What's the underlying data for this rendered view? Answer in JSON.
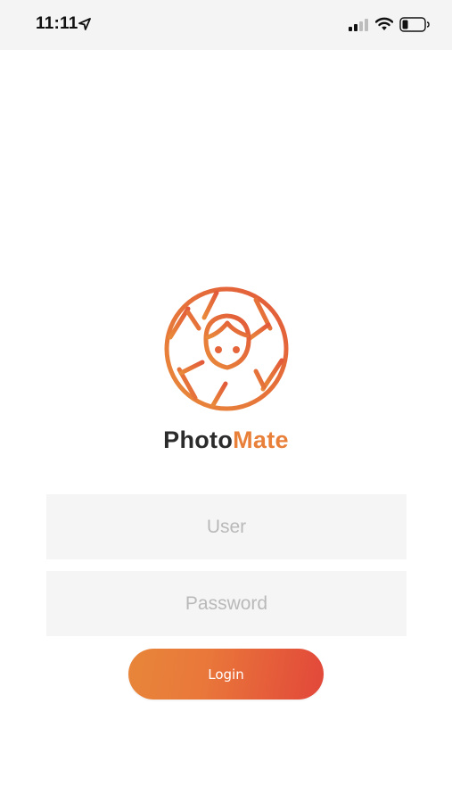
{
  "status_bar": {
    "time": "11:11",
    "icons": [
      "location-arrow-icon",
      "cellular-signal-icon",
      "wifi-icon",
      "battery-icon"
    ]
  },
  "brand": {
    "name_part1": "Photo",
    "name_part2": "Mate",
    "logo": "aperture-face-logo"
  },
  "form": {
    "user_placeholder": "User",
    "user_value": "",
    "password_placeholder": "Password",
    "password_value": "",
    "login_label": "Login"
  },
  "colors": {
    "accent_light": "#e8863a",
    "accent_dark": "#e2473a",
    "field_background": "#f5f5f5",
    "status_bar_background": "#f4f4f4"
  }
}
